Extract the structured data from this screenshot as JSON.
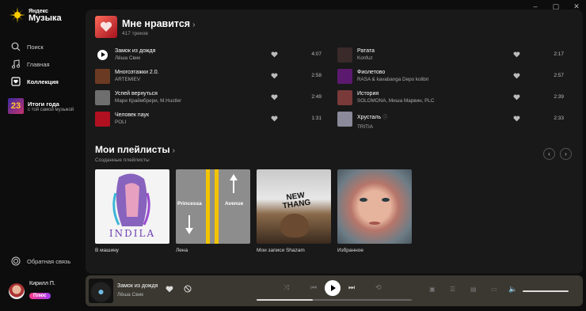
{
  "window_controls": [
    "–",
    "▢",
    "✕"
  ],
  "logo": {
    "line1": "Яндекс",
    "line2": "Музыка"
  },
  "nav": [
    {
      "label": "Поиск",
      "icon": "search-icon"
    },
    {
      "label": "Главная",
      "icon": "music-note-icon"
    },
    {
      "label": "Коллекция",
      "icon": "collection-icon",
      "active": true
    }
  ],
  "promo": {
    "badge": "23",
    "title": "Итоги года",
    "subtitle": "с той самой музыкой"
  },
  "feedback": {
    "label": "Обратная связь"
  },
  "user": {
    "name": "Кирилл П.",
    "plus": "Плюс"
  },
  "liked": {
    "title": "Мне нравится",
    "count": "417 треков"
  },
  "tracks": [
    {
      "title": "Замок из дождя",
      "artist": "Лёша Свик",
      "duration": "4:07",
      "cover": "play"
    },
    {
      "title": "Многоэтажки 2.0.",
      "artist": "ARTEMIEV",
      "duration": "2:58",
      "cover": "#6b3a22"
    },
    {
      "title": "Успей вернуться",
      "artist": "Мари Краймбрери, M.Hustler",
      "duration": "2:49",
      "cover": "#6e6e6e"
    },
    {
      "title": "Человек паук",
      "artist": "POLI",
      "duration": "1:31",
      "cover": "#b01020"
    },
    {
      "title": "Ратата",
      "artist": "Konfuz",
      "duration": "2:17",
      "cover": "#3a2a2a"
    },
    {
      "title": "Фиолетово",
      "artist": "RASA & kavabanga Depo kolibri",
      "duration": "2:57",
      "cover": "#5b1a6e"
    },
    {
      "title": "История",
      "artist": "SOLOMONA, Миша Марвин, PLC",
      "duration": "2:39",
      "cover": "#7a3a3a"
    },
    {
      "title": "Хрусталь",
      "artist": "TRITIA",
      "duration": "2:33",
      "cover": "#8a8a9a",
      "explicit": "ⓘ"
    }
  ],
  "playlists_section": {
    "title": "Мои плейлисты",
    "subtitle": "Созданные плейлисты"
  },
  "playlists": [
    {
      "name": "В машину",
      "cover_text": "INDILA"
    },
    {
      "name": "Лена",
      "cover_text_left": "Princessa",
      "cover_text_right": "Avenue"
    },
    {
      "name": "Мои записи Shazam",
      "cover_text": "NEW THANG"
    },
    {
      "name": "Избранное"
    }
  ],
  "player": {
    "title": "Замок из дождя",
    "artist": "Лёша Свик",
    "progress": 0.36
  },
  "colors": {
    "accent": "#ffcc00",
    "bg": "#0d0d0d",
    "panel": "#191919",
    "player": "#3a3830"
  }
}
